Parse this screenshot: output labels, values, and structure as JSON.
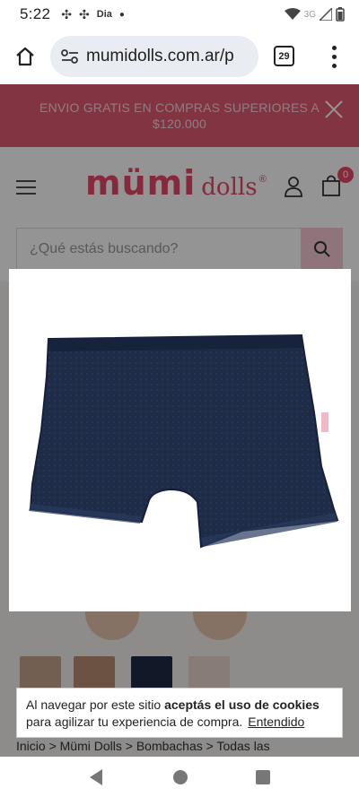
{
  "status_bar": {
    "time": "5:22",
    "carrier_badge": "Dia",
    "network": "3G"
  },
  "browser": {
    "url": "mumidolls.com.ar/p",
    "tab_count": "29"
  },
  "promo": {
    "text": "ENVIO GRATIS EN COMPRAS SUPERIORES A $120.000"
  },
  "header": {
    "logo_main": "mümi",
    "logo_secondary": "dolls",
    "logo_reg": "®",
    "cart_count": "0"
  },
  "search": {
    "placeholder": "¿Qué estás buscando?"
  },
  "breadcrumb": {
    "text": "Inicio > Mümi Dolls > Bombachas > Todas las"
  },
  "cookie": {
    "text_before": "Al navegar por este sitio ",
    "text_bold": "aceptás el uso de cookies",
    "text_after": " para agilizar tu experiencia de compra.",
    "link": "Entendido"
  },
  "colors": {
    "brand_pink": "#e8476a",
    "promo_bg": "#e05a72",
    "product_navy": "#1e2a45"
  }
}
